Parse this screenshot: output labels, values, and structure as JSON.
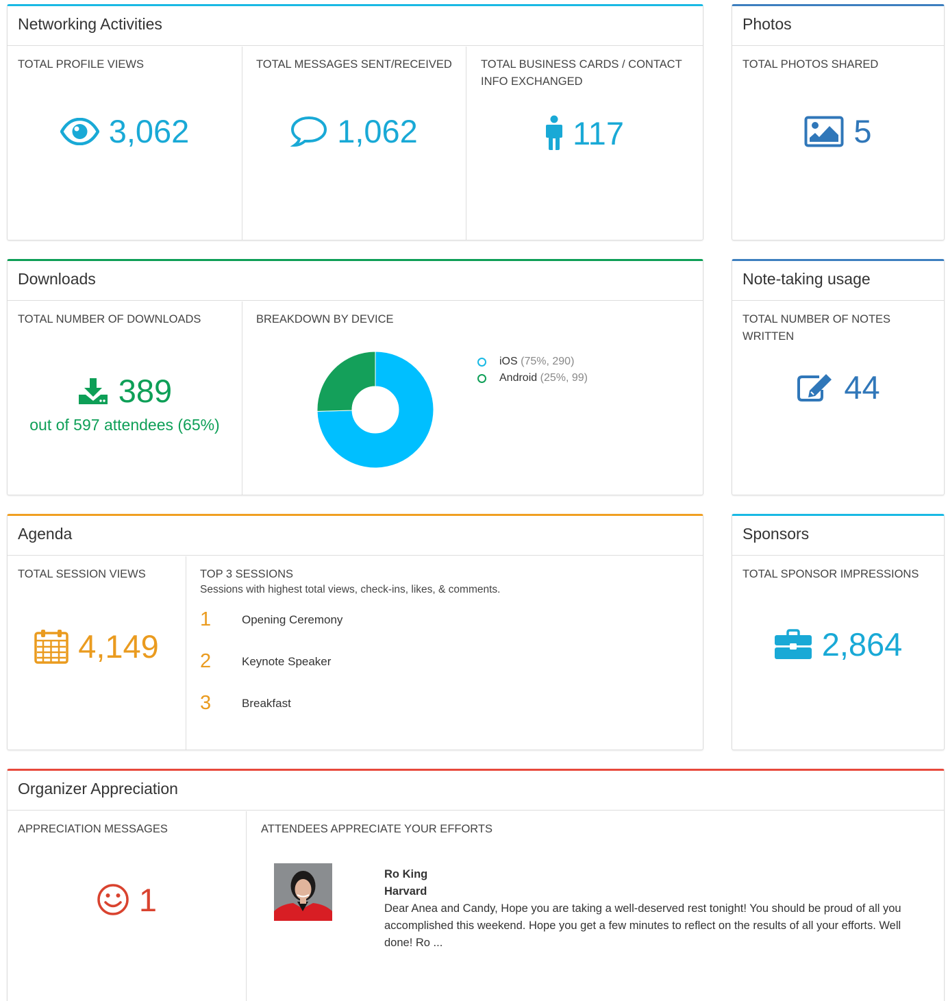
{
  "networking": {
    "title": "Networking Activities",
    "profile_views": {
      "label": "TOTAL PROFILE VIEWS",
      "value": "3,062",
      "icon": "eye-icon"
    },
    "messages": {
      "label": "TOTAL MESSAGES SENT/RECEIVED",
      "value": "1,062",
      "icon": "speech-bubble-icon"
    },
    "business_cards": {
      "label": "TOTAL BUSINESS CARDS / CONTACT INFO EXCHANGED",
      "value": "117",
      "icon": "person-icon"
    }
  },
  "photos": {
    "title": "Photos",
    "label": "TOTAL PHOTOS SHARED",
    "value": "5",
    "icon": "image-icon"
  },
  "downloads": {
    "title": "Downloads",
    "total_label": "TOTAL NUMBER OF DOWNLOADS",
    "value": "389",
    "subtext": "out of 597 attendees (65%)",
    "icon": "download-icon",
    "breakdown_label": "BREAKDOWN BY DEVICE",
    "legend": [
      {
        "name": "iOS",
        "detail": "(75%, 290)",
        "color": "#00bfff"
      },
      {
        "name": "Android",
        "detail": "(25%, 99)",
        "color": "#14a05a"
      }
    ]
  },
  "chart_data": {
    "type": "pie",
    "categories": [
      "iOS",
      "Android"
    ],
    "values": [
      290,
      99
    ],
    "percent": [
      75,
      25
    ],
    "colors": [
      "#00bfff",
      "#14a05a"
    ],
    "title": "",
    "xlabel": "",
    "ylabel": ""
  },
  "notes": {
    "title": "Note-taking usage",
    "label": "TOTAL NUMBER OF NOTES WRITTEN",
    "value": "44",
    "icon": "edit-icon"
  },
  "agenda": {
    "title": "Agenda",
    "views_label": "TOTAL SESSION VIEWS",
    "value": "4,149",
    "icon": "calendar-icon",
    "top_label": "TOP 3 SESSIONS",
    "top_sub": "Sessions with highest total views, check-ins, likes, & comments.",
    "sessions": [
      {
        "rank": "1",
        "name": "Opening Ceremony"
      },
      {
        "rank": "2",
        "name": "Keynote Speaker"
      },
      {
        "rank": "3",
        "name": "Breakfast"
      }
    ]
  },
  "sponsors": {
    "title": "Sponsors",
    "label": "TOTAL SPONSOR IMPRESSIONS",
    "value": "2,864",
    "icon": "briefcase-icon"
  },
  "appreciation": {
    "title": "Organizer Appreciation",
    "messages_label": "APPRECIATION MESSAGES",
    "value": "1",
    "icon": "smiley-icon",
    "attendees_label": "ATTENDEES APPRECIATE YOUR EFFORTS",
    "message": {
      "name": "Ro King",
      "org": "Harvard",
      "text": "Dear Anea and Candy, Hope you are taking a well-deserved rest tonight! You should be proud of all you accomplished this weekend. Hope you get a few minutes to reflect on the results of all your efforts. Well done! Ro ..."
    }
  }
}
